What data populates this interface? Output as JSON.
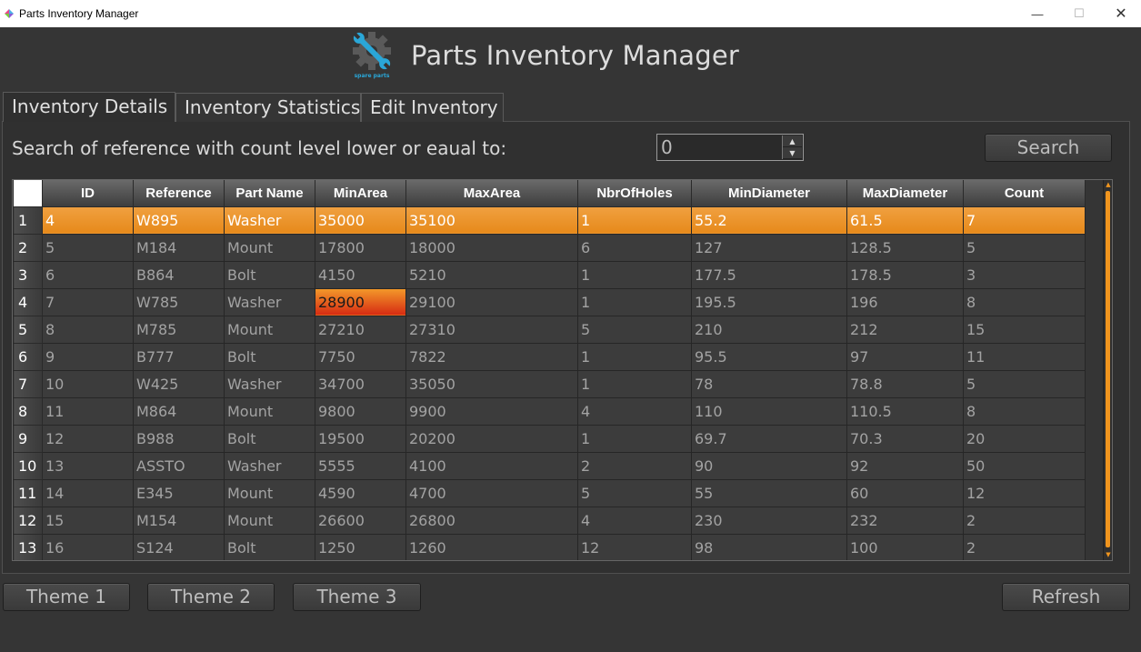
{
  "window": {
    "title": "Parts Inventory Manager",
    "minimize": "—",
    "maximize": "☐",
    "close": "✕"
  },
  "header": {
    "logo_icon": "gear-wrench-icon",
    "logo_text": "spare parts",
    "title": "Parts Inventory Manager"
  },
  "tabs": [
    {
      "label": "Inventory Details",
      "active": true
    },
    {
      "label": "Inventory Statistics",
      "active": false
    },
    {
      "label": "Edit Inventory",
      "active": false
    }
  ],
  "search": {
    "label": "Search of reference with count level lower or eaual to:",
    "value": "0",
    "button": "Search"
  },
  "table": {
    "columns": [
      "ID",
      "Reference",
      "Part Name",
      "MinArea",
      "MaxArea",
      "NbrOfHoles",
      "MinDiameter",
      "MaxDiameter",
      "Count"
    ],
    "selected_row": 1,
    "highlight": {
      "row": 4,
      "column": "MinArea"
    },
    "rows": [
      [
        "1",
        "4",
        "W895",
        "Washer",
        "35000",
        "35100",
        "1",
        "55.2",
        "61.5",
        "7"
      ],
      [
        "2",
        "5",
        "M184",
        "Mount",
        "17800",
        "18000",
        "6",
        "127",
        "128.5",
        "5"
      ],
      [
        "3",
        "6",
        "B864",
        "Bolt",
        "4150",
        "5210",
        "1",
        "177.5",
        "178.5",
        "3"
      ],
      [
        "4",
        "7",
        "W785",
        "Washer",
        "28900",
        "29100",
        "1",
        "195.5",
        "196",
        "8"
      ],
      [
        "5",
        "8",
        "M785",
        "Mount",
        "27210",
        "27310",
        "5",
        "210",
        "212",
        "15"
      ],
      [
        "6",
        "9",
        "B777",
        "Bolt",
        "7750",
        "7822",
        "1",
        "95.5",
        "97",
        "11"
      ],
      [
        "7",
        "10",
        "W425",
        "Washer",
        "34700",
        "35050",
        "1",
        "78",
        "78.8",
        "5"
      ],
      [
        "8",
        "11",
        "M864",
        "Mount",
        "9800",
        "9900",
        "4",
        "110",
        "110.5",
        "8"
      ],
      [
        "9",
        "12",
        "B988",
        "Bolt",
        "19500",
        "20200",
        "1",
        "69.7",
        "70.3",
        "20"
      ],
      [
        "10",
        "13",
        "ASSTO",
        "Washer",
        "5555",
        "4100",
        "2",
        "90",
        "92",
        "50"
      ],
      [
        "11",
        "14",
        "E345",
        "Mount",
        "4590",
        "4700",
        "5",
        "55",
        "60",
        "12"
      ],
      [
        "12",
        "15",
        "M154",
        "Mount",
        "26600",
        "26800",
        "4",
        "230",
        "232",
        "2"
      ],
      [
        "13",
        "16",
        "S124",
        "Bolt",
        "1250",
        "1260",
        "12",
        "98",
        "100",
        "2"
      ]
    ]
  },
  "buttons": {
    "theme1": "Theme 1",
    "theme2": "Theme 2",
    "theme3": "Theme 3",
    "refresh": "Refresh"
  },
  "colors": {
    "accent": "#f0951e",
    "highlight_end": "#d62a12",
    "logo": "#2aa7d8",
    "background": "#353535"
  }
}
